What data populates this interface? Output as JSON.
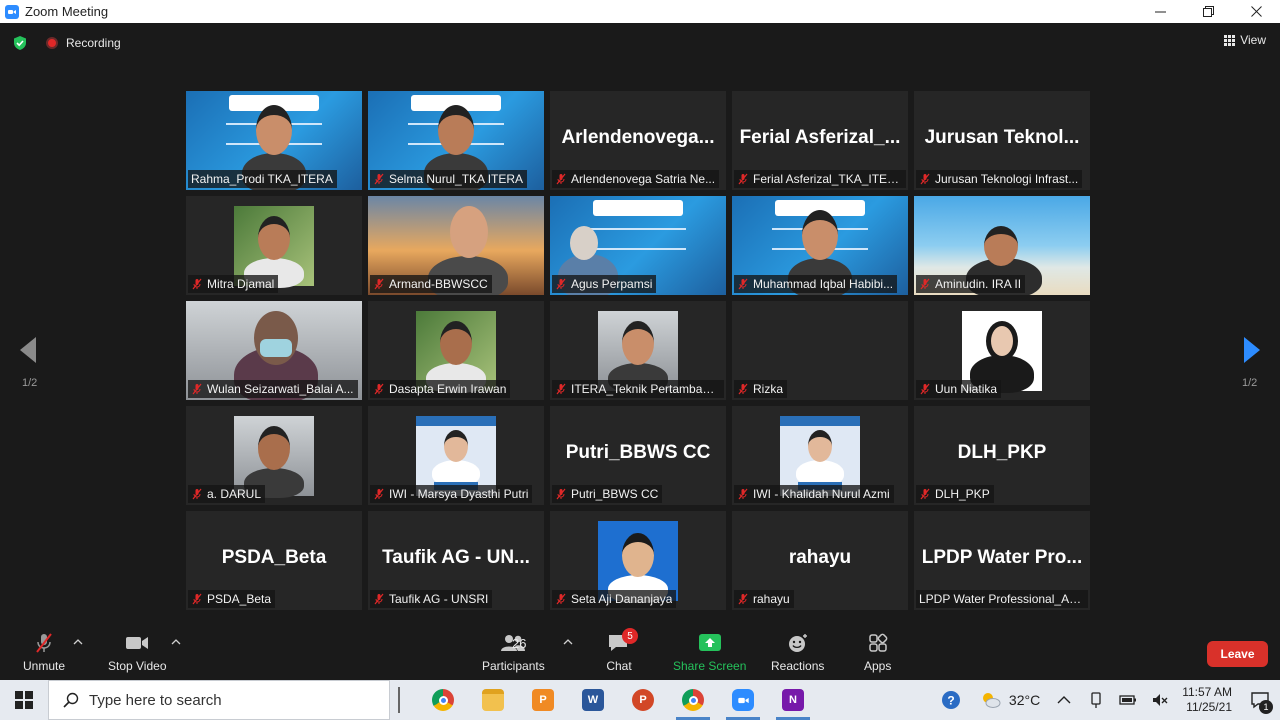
{
  "window": {
    "title": "Zoom Meeting"
  },
  "topbar": {
    "recording_label": "Recording",
    "view_label": "View"
  },
  "tiles": [
    {
      "name": "Rahma_Prodi TKA_ITERA",
      "big": "",
      "muted": false,
      "active": true,
      "video": "slide-person"
    },
    {
      "name": "Selma Nurul_TKA ITERA",
      "big": "",
      "muted": true,
      "active": false,
      "video": "slide-person"
    },
    {
      "name": "Arlendenovega Satria Ne...",
      "big": "Arlendenovega...",
      "muted": true,
      "active": false,
      "video": ""
    },
    {
      "name": "Ferial Asferizal_TKA_ITERA",
      "big": "Ferial Asferizal_...",
      "muted": true,
      "active": false,
      "video": ""
    },
    {
      "name": "Jurusan Teknologi Infrast...",
      "big": "Jurusan Teknol...",
      "muted": true,
      "active": false,
      "video": ""
    },
    {
      "name": "Mitra Djamal",
      "big": "",
      "muted": true,
      "active": false,
      "video": "small-photo-green"
    },
    {
      "name": "Armand-BBWSCC",
      "big": "",
      "muted": true,
      "active": false,
      "video": "sunset-person"
    },
    {
      "name": "Agus Perpamsi",
      "big": "",
      "muted": true,
      "active": false,
      "video": "slide-side"
    },
    {
      "name": "Muhammad Iqbal Habibi...",
      "big": "",
      "muted": true,
      "active": false,
      "video": "slide-person"
    },
    {
      "name": "Aminudin. IRA II",
      "big": "",
      "muted": true,
      "active": false,
      "video": "beach-person"
    },
    {
      "name": "Wulan Seizarwati_Balai A...",
      "big": "",
      "muted": true,
      "active": false,
      "video": "room-person"
    },
    {
      "name": "Dasapta Erwin Irawan",
      "big": "",
      "muted": true,
      "active": false,
      "video": "small-photo-green"
    },
    {
      "name": "ITERA_Teknik Pertambang...",
      "big": "",
      "muted": true,
      "active": false,
      "video": "small-photo-grey"
    },
    {
      "name": "Rizka",
      "big": "",
      "muted": true,
      "active": false,
      "video": ""
    },
    {
      "name": "Uun Niatika",
      "big": "",
      "muted": true,
      "active": false,
      "video": "small-photo-white"
    },
    {
      "name": "a. DARUL",
      "big": "",
      "muted": true,
      "active": false,
      "video": "small-photo-grey"
    },
    {
      "name": "IWI - Marsya Dyasthi Putri",
      "big": "",
      "muted": true,
      "active": false,
      "video": "small-photo-card"
    },
    {
      "name": "Putri_BBWS CC",
      "big": "Putri_BBWS CC",
      "muted": true,
      "active": false,
      "video": ""
    },
    {
      "name": "IWI - Khalidah Nurul Azmi",
      "big": "",
      "muted": true,
      "active": false,
      "video": "small-photo-card"
    },
    {
      "name": "DLH_PKP",
      "big": "DLH_PKP",
      "muted": true,
      "active": false,
      "video": ""
    },
    {
      "name": "PSDA_Beta",
      "big": "PSDA_Beta",
      "muted": true,
      "active": false,
      "video": ""
    },
    {
      "name": "Taufik AG - UNSRI",
      "big": "Taufik AG - UN...",
      "muted": true,
      "active": false,
      "video": ""
    },
    {
      "name": "Seta Aji Dananjaya",
      "big": "",
      "muted": true,
      "active": false,
      "video": "small-photo-blue"
    },
    {
      "name": "rahayu",
      "big": "rahayu",
      "muted": true,
      "active": false,
      "video": ""
    },
    {
      "name": "LPDP Water Professional_Ari...",
      "big": "LPDP Water Pro...",
      "muted": false,
      "active": false,
      "video": ""
    }
  ],
  "pager": {
    "left": "1/2",
    "right": "1/2"
  },
  "toolbar": {
    "unmute": "Unmute",
    "stop_video": "Stop Video",
    "participants": "Participants",
    "participants_count": "26",
    "chat": "Chat",
    "chat_badge": "5",
    "share_screen": "Share Screen",
    "reactions": "Reactions",
    "apps": "Apps",
    "leave": "Leave"
  },
  "taskbar": {
    "search_placeholder": "Type here to search",
    "temperature": "32°C",
    "time": "11:57 AM",
    "date": "11/25/21",
    "notification_count": "1"
  },
  "colors": {
    "accent_green": "#c7e07f",
    "leave_red": "#d9312a",
    "share_green": "#25c15b",
    "zoom_blue": "#2d8cff"
  }
}
